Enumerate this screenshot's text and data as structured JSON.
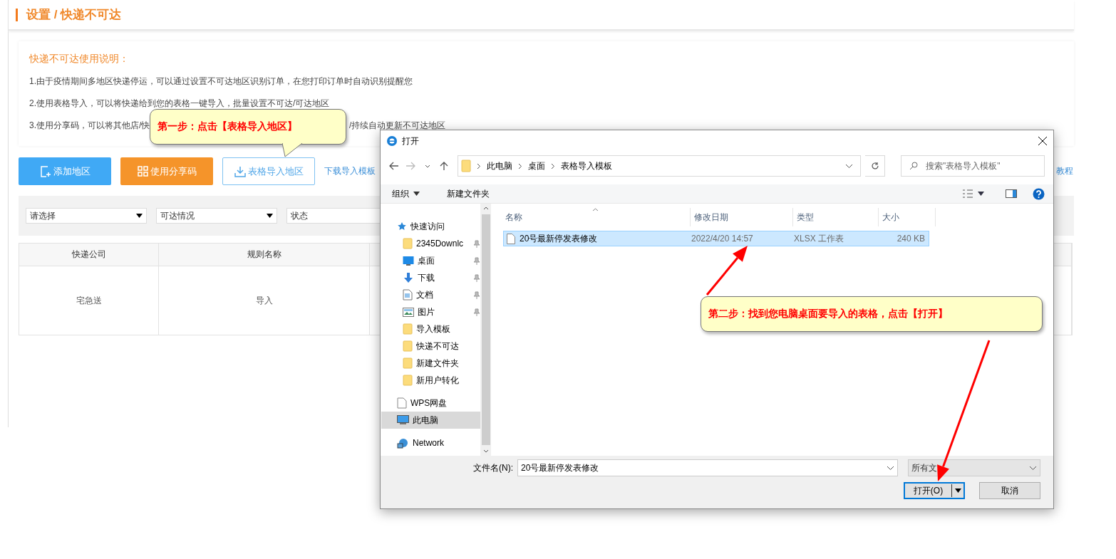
{
  "page": {
    "title": "设置 / 快递不可达"
  },
  "instructions": {
    "heading": "快递不可达使用说明：",
    "lines": [
      {
        "parts": [
          "1.由于疫情期间多地区快递停运，可以通过设置不可达地区识别订单，在您打印订单时自动识别提醒您"
        ]
      },
      {
        "parts": [
          "2.使用表格导入，可以将快递给到您的表格一键导入，批量设置不可达/可达地区"
        ]
      },
      {
        "parts": [
          "3.使用分享码，可以将其他店/快",
          "/持续自动更新不可达地区"
        ]
      }
    ]
  },
  "actions": [
    {
      "label": "添加地区",
      "kind": "primary"
    },
    {
      "label": "使用分享码",
      "kind": "warning"
    },
    {
      "label": "表格导入地区",
      "kind": "outline"
    }
  ],
  "links": [
    "下载导入模板",
    "教程"
  ],
  "filters": [
    "请选择",
    "可达情况",
    "状态"
  ],
  "table": {
    "columns": [
      "快递公司",
      "规则名称"
    ],
    "rows": [
      [
        "宅急送",
        "导入"
      ]
    ]
  },
  "dialog": {
    "title": "打开",
    "breadcrumb": [
      "此电脑",
      "桌面",
      "表格导入模板"
    ],
    "search_placeholder": "搜索\"表格导入模板\"",
    "toolbar": [
      "组织",
      "新建文件夹"
    ],
    "nav": [
      {
        "label": "快速访问",
        "kind": "star",
        "pinned": false,
        "selected": false
      },
      {
        "label": "2345Downlc",
        "kind": "folder",
        "pinned": true,
        "selected": false
      },
      {
        "label": "桌面",
        "kind": "desktop",
        "pinned": true,
        "selected": false
      },
      {
        "label": "下载",
        "kind": "download",
        "pinned": true,
        "selected": false
      },
      {
        "label": "文档",
        "kind": "document",
        "pinned": true,
        "selected": false
      },
      {
        "label": "图片",
        "kind": "picture",
        "pinned": true,
        "selected": false
      },
      {
        "label": "导入模板",
        "kind": "folder",
        "pinned": false,
        "selected": false
      },
      {
        "label": "快递不可达",
        "kind": "folder",
        "pinned": false,
        "selected": false
      },
      {
        "label": "新建文件夹",
        "kind": "folder",
        "pinned": false,
        "selected": false
      },
      {
        "label": "新用户转化",
        "kind": "folder",
        "pinned": false,
        "selected": false
      },
      {
        "label": "WPS网盘",
        "kind": "cloud",
        "pinned": false,
        "selected": false
      },
      {
        "label": "此电脑",
        "kind": "computer",
        "pinned": false,
        "selected": true
      },
      {
        "label": "Network",
        "kind": "network",
        "pinned": false,
        "selected": false
      }
    ],
    "columns": [
      "名称",
      "修改日期",
      "类型",
      "大小"
    ],
    "files": [
      {
        "name": "20号最新停发表修改",
        "date": "2022/4/20 14:57",
        "type": "XLSX 工作表",
        "size": "240 KB",
        "selected": true
      }
    ],
    "filename_label": "文件名(N):",
    "filename": "20号最新停发表修改",
    "filetype": "所有文",
    "open_button": "打开(O)",
    "cancel_button": "取消"
  },
  "callouts": [
    "第一步：点击【表格导入地区】",
    "第二步：找到您电脑桌面要导入的表格，点击【打开】"
  ]
}
